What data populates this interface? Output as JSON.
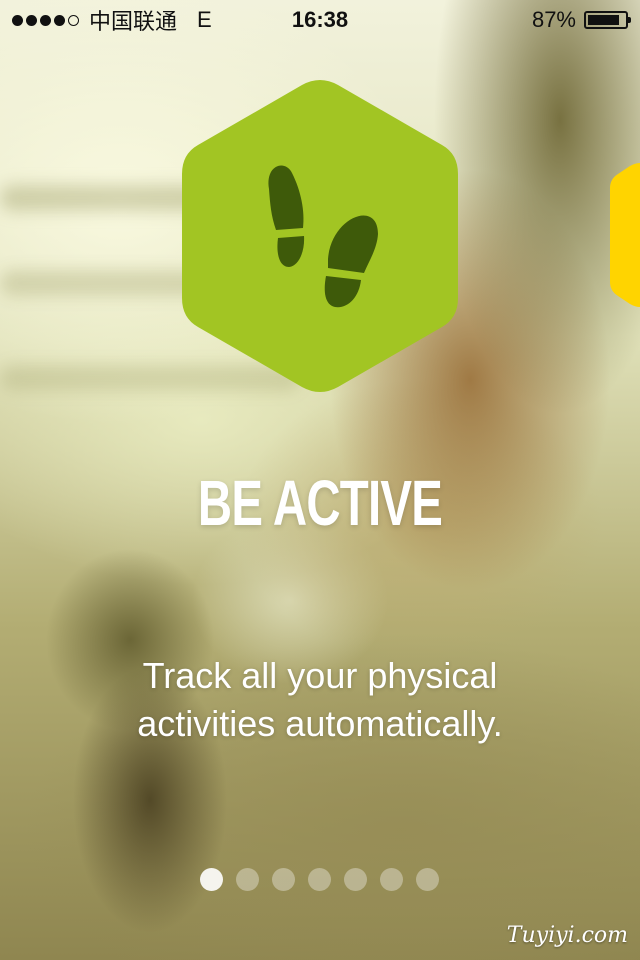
{
  "status_bar": {
    "carrier": "中国联通",
    "network": "E",
    "time": "16:38",
    "battery_percent": "87%",
    "battery_level": 0.87,
    "signal_bars_filled": 4,
    "signal_bars_total": 5
  },
  "onboarding": {
    "icon": "footprints-icon",
    "title": "BE ACTIVE",
    "subtitle_line1": "Track all your physical",
    "subtitle_line2": "activities automatically.",
    "page_count": 7,
    "active_page": 1
  },
  "watermark": "Tuyiyi.com",
  "colors": {
    "badge_green": "#a2c523",
    "footprint_dark": "#3e5a0a",
    "next_badge_yellow": "#ffd400",
    "text": "#ffffff"
  }
}
